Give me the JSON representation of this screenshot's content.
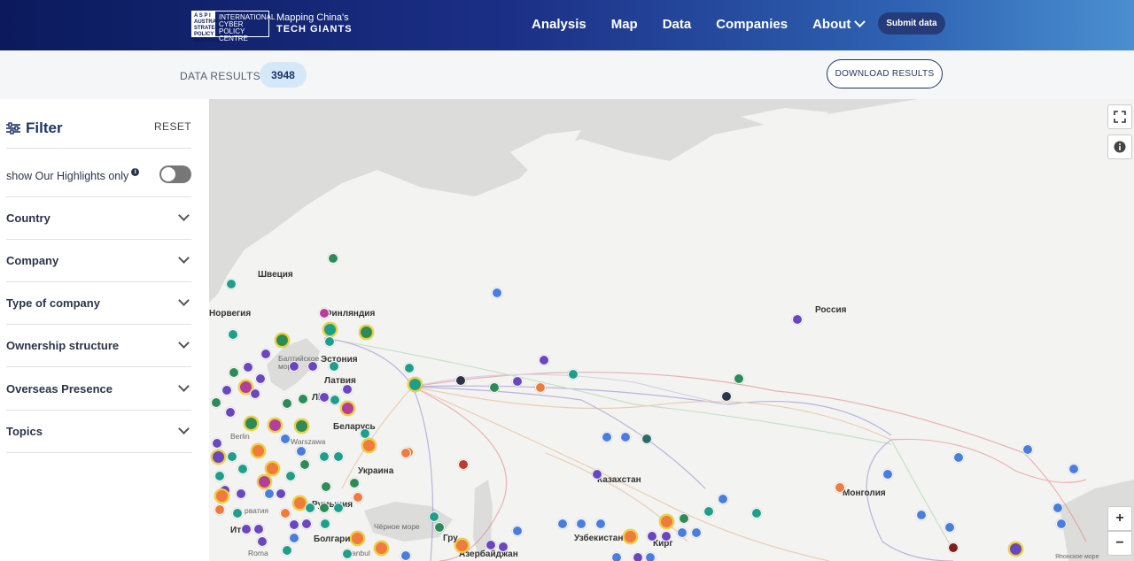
{
  "header": {
    "logo_aspi": "A S P I AUSTRALIAN STRATEGIC POLICY INSTITUTE",
    "logo_icpc": "INTERNATIONAL CYBER POLICY CENTRE",
    "logo_title_line1": "Mapping China's",
    "logo_title_line2": "TECH GIANTS",
    "nav": [
      "Analysis",
      "Map",
      "Data",
      "Companies",
      "About"
    ],
    "submit_label": "Submit data"
  },
  "results": {
    "label": "DATA RESULTS",
    "count": "3948",
    "download_label": "DOWNLOAD RESULTS"
  },
  "sidebar": {
    "title": "Filter",
    "reset_label": "RESET",
    "highlights_label": "show Our Highlights only",
    "highlights_on": false,
    "filters": [
      "Country",
      "Company",
      "Type of company",
      "Ownership structure",
      "Overseas Presence",
      "Topics"
    ]
  },
  "map": {
    "labels": {
      "russia": "Россия",
      "sweden": "Швеция",
      "norway": "Норвегия",
      "finland": "Финляндия",
      "estonia": "Эстония",
      "latvia": "Латвия",
      "lithuania": "Лі",
      "belarus": "Беларусь",
      "ukraine": "Украина",
      "kazakhstan": "Казахстан",
      "mongolia": "Монголия",
      "uzbekistan": "Узбекистан",
      "kyrgyzstan": "Кирг",
      "bulgaria": "Болгария",
      "romania": "Румыния",
      "georgia": "Гру",
      "azerbaijan": "Азербайджан",
      "baltic_sea": "Балтийское море",
      "black_sea": "Чёрное море",
      "warsaw": "Warszawa",
      "berlin": "Berlin",
      "roma": "Roma",
      "istanbul": "İstanbul",
      "sea_of_japan": "Японское море",
      "croatia": "рватия",
      "italy": "Ит"
    },
    "fullscreen_icon": "fullscreen-icon",
    "info_icon": "info-icon",
    "zoom_in": "+",
    "zoom_out": "−",
    "colors": {
      "teal": "#1f9f8a",
      "purple": "#6b46c1",
      "blue": "#4a7de0",
      "orange": "#f07b3f",
      "green": "#2e8b57",
      "red": "#c0392b",
      "magenta": "#b43f9a",
      "highlight": "#f2d22c"
    }
  }
}
